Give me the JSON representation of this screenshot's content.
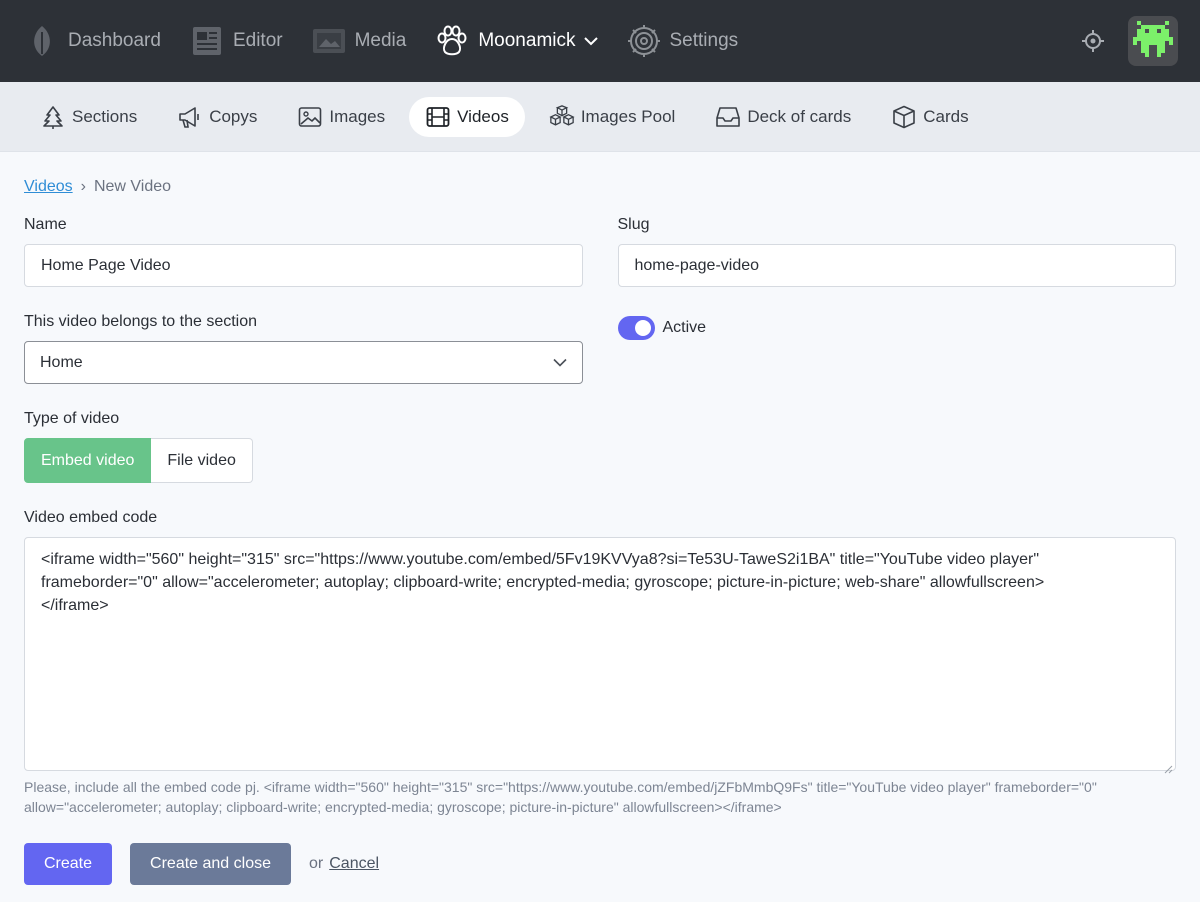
{
  "topnav": {
    "items": [
      {
        "label": "Dashboard",
        "icon": "leaf-icon"
      },
      {
        "label": "Editor",
        "icon": "newspaper-icon"
      },
      {
        "label": "Media",
        "icon": "photo-icon"
      },
      {
        "label": "Moonamick",
        "icon": "paw-icon"
      },
      {
        "label": "Settings",
        "icon": "gear-icon"
      }
    ]
  },
  "subnav": {
    "items": [
      {
        "label": "Sections",
        "icon": "tree-icon"
      },
      {
        "label": "Copys",
        "icon": "megaphone-icon"
      },
      {
        "label": "Images",
        "icon": "image-icon"
      },
      {
        "label": "Videos",
        "icon": "film-icon"
      },
      {
        "label": "Images Pool",
        "icon": "cubes-icon"
      },
      {
        "label": "Deck of cards",
        "icon": "inbox-icon"
      },
      {
        "label": "Cards",
        "icon": "box-icon"
      }
    ]
  },
  "breadcrumb": {
    "parent": "Videos",
    "separator": "›",
    "current": "New Video"
  },
  "form": {
    "name_label": "Name",
    "name_value": "Home Page Video",
    "slug_label": "Slug",
    "slug_value": "home-page-video",
    "section_label": "This video belongs to the section",
    "section_value": "Home",
    "active_label": "Active",
    "type_label": "Type of video",
    "type_embed": "Embed video",
    "type_file": "File video",
    "embed_label": "Video embed code",
    "embed_line1": "<iframe width=\"560\" height=\"315\" src=\"https://www.youtube.com/embed/5Fv19KVVya8?si=Te53U-TaweS2i1BA\" title=\"YouTube video player\"",
    "embed_line2": "frameborder=\"0\" allow=\"accelerometer; autoplay; clipboard-write; encrypted-media; gyroscope; picture-in-picture; web-share\" allowfullscreen>",
    "embed_line3": "</iframe>",
    "hint": "Please, include all the embed code pj. <iframe width=\"560\" height=\"315\" src=\"https://www.youtube.com/embed/jZFbMmbQ9Fs\" title=\"YouTube video player\" frameborder=\"0\" allow=\"accelerometer; autoplay; clipboard-write; encrypted-media; gyroscope; picture-in-picture\" allowfullscreen></iframe>"
  },
  "actions": {
    "create": "Create",
    "create_close": "Create and close",
    "or": "or",
    "cancel": "Cancel"
  },
  "colors": {
    "topbar": "#2d3137",
    "accent": "#6366f1",
    "embed_active": "#68c48a",
    "secondary_button": "#6b7a99",
    "link": "#2f8dd6"
  }
}
